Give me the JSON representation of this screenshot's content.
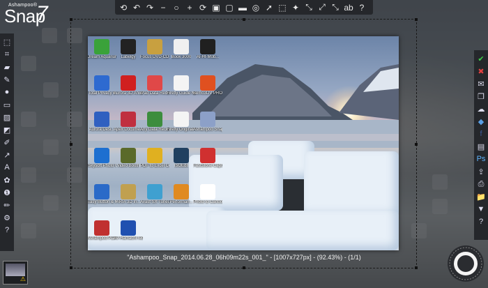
{
  "app": {
    "brand": "Ashampoo®",
    "name": "Snap",
    "version": "7"
  },
  "top_toolbar": [
    {
      "name": "undo-all-icon",
      "glyph": "⟲"
    },
    {
      "name": "undo-icon",
      "glyph": "↶"
    },
    {
      "name": "redo-icon",
      "glyph": "↷"
    },
    {
      "name": "zoom-out-icon",
      "glyph": "−"
    },
    {
      "name": "zoom-fit-icon",
      "glyph": "○"
    },
    {
      "name": "zoom-in-icon",
      "glyph": "+"
    },
    {
      "name": "rotate-icon",
      "glyph": "⟳"
    },
    {
      "name": "image-icon",
      "glyph": "▣"
    },
    {
      "name": "crop-frame-icon",
      "glyph": "▢"
    },
    {
      "name": "window-frame-icon",
      "glyph": "▬"
    },
    {
      "name": "target-icon",
      "glyph": "◎"
    },
    {
      "name": "pointer-icon",
      "glyph": "➚"
    },
    {
      "name": "cursor-select-icon",
      "glyph": "⬚"
    },
    {
      "name": "magic-wand-icon",
      "glyph": "✦"
    },
    {
      "name": "resize-icon",
      "glyph": "⤡"
    },
    {
      "name": "expand-icon",
      "glyph": "⤢"
    },
    {
      "name": "shrink-icon",
      "glyph": "⤡"
    },
    {
      "name": "text-recognition-icon",
      "glyph": "ab"
    },
    {
      "name": "help-icon",
      "glyph": "?"
    }
  ],
  "left_toolbar": [
    {
      "name": "selection-icon",
      "glyph": "⬚"
    },
    {
      "name": "crop-icon",
      "glyph": "⌗"
    },
    {
      "name": "eraser-icon",
      "glyph": "▰"
    },
    {
      "name": "highlighter-icon",
      "glyph": "✎"
    },
    {
      "name": "drop-icon",
      "glyph": "●"
    },
    {
      "name": "rectangle-icon",
      "glyph": "▭"
    },
    {
      "name": "blur-icon",
      "glyph": "▨"
    },
    {
      "name": "fill-icon",
      "glyph": "◩"
    },
    {
      "name": "pen-icon",
      "glyph": "✐"
    },
    {
      "name": "arrow-icon",
      "glyph": "↗"
    },
    {
      "name": "text-icon",
      "glyph": "A"
    },
    {
      "name": "stamp-icon",
      "glyph": "✿"
    },
    {
      "name": "numbering-icon",
      "glyph": "❶"
    },
    {
      "name": "pencil-icon",
      "glyph": "✏"
    },
    {
      "name": "settings-icon",
      "glyph": "⚙"
    },
    {
      "name": "help-icon",
      "glyph": "?"
    }
  ],
  "right_toolbar": [
    {
      "name": "confirm-icon",
      "glyph": "✔",
      "color": "#3fcf4a"
    },
    {
      "name": "cancel-icon",
      "glyph": "✖",
      "color": "#e24040"
    },
    {
      "name": "email-icon",
      "glyph": "✉",
      "color": "#dde"
    },
    {
      "name": "copy-icon",
      "glyph": "❐",
      "color": "#dde"
    },
    {
      "name": "cloud-icon",
      "glyph": "☁",
      "color": "#dde"
    },
    {
      "name": "dropbox-icon",
      "glyph": "◆",
      "color": "#5aa0e6"
    },
    {
      "name": "facebook-icon",
      "glyph": "f",
      "color": "#3b5998"
    },
    {
      "name": "document-icon",
      "glyph": "▤",
      "color": "#dde"
    },
    {
      "name": "photoshop-icon",
      "glyph": "Ps",
      "color": "#5fb5ff"
    },
    {
      "name": "export-icon",
      "glyph": "⇪",
      "color": "#dde"
    },
    {
      "name": "print-icon",
      "glyph": "⎙",
      "color": "#dde"
    },
    {
      "name": "folder-icon",
      "glyph": "📁",
      "color": "#e8c25a"
    },
    {
      "name": "save-icon",
      "glyph": "▼",
      "color": "#dde"
    },
    {
      "name": "help-icon",
      "glyph": "?",
      "color": "#dde"
    }
  ],
  "desktop_icons": [
    {
      "label": "Dream Aquarium",
      "color": "#3aa23a"
    },
    {
      "label": "Labelgy",
      "color": "#222"
    },
    {
      "label": "Focus DVD-CD-C...",
      "color": "#c8a040"
    },
    {
      "label": "Book 3000",
      "color": "#f0f0f0"
    },
    {
      "label": "AI-HI-Mob...",
      "color": "#202020"
    },
    {
      "label": "Total Privacy 6",
      "color": "#2e6ad0"
    },
    {
      "label": "Aurora 3D Animati...",
      "color": "#d02020"
    },
    {
      "label": "iPad Data Recovery (L...",
      "color": "#e04848"
    },
    {
      "label": "Firefly Guide NoR...",
      "color": "#f4f4f4"
    },
    {
      "label": "Bemo3DV PRO",
      "color": "#e05020"
    },
    {
      "label": "Aurora Desi...",
      "color": "#3060c0"
    },
    {
      "label": "Apex Docume...",
      "color": "#c03040"
    },
    {
      "label": "Any Data Recovery Pro",
      "color": "#3d8d3d"
    },
    {
      "label": "Firefly Original T...",
      "color": "#f4f4f4"
    },
    {
      "label": "Ashampoo Snap 7",
      "color": "#8ca0c8"
    },
    {
      "label": "iSkysoft Photo Geode-3D",
      "color": "#1d6fd0"
    },
    {
      "label": "Video Booth",
      "color": "#5a6a2a"
    },
    {
      "label": "PDF to Excel Conve...",
      "color": "#e0b020"
    },
    {
      "label": "ISOEdit",
      "color": "#204060"
    },
    {
      "label": "FastStone Capture",
      "color": "#d03030"
    },
    {
      "label": "Easy Button & Menu ...",
      "color": "#2a6ac8"
    },
    {
      "label": "ARIA 3D In...",
      "color": "#c0a050"
    },
    {
      "label": "Avast SX Tuneup 2014",
      "color": "#3fa0d0"
    },
    {
      "label": "Performan...",
      "color": "#e08a20"
    },
    {
      "label": "Photo to Cartoon",
      "color": "#ffffff"
    },
    {
      "label": "Ashampoo PDF Bran...",
      "color": "#c03030"
    },
    {
      "label": "AV-Hamachi rebuild...",
      "color": "#2050b0"
    }
  ],
  "caption": "\"Ashampoo_Snap_2014.06.28_06h09m22s_001_\" - [1007x727px] - (92.43%) - (1/1)"
}
